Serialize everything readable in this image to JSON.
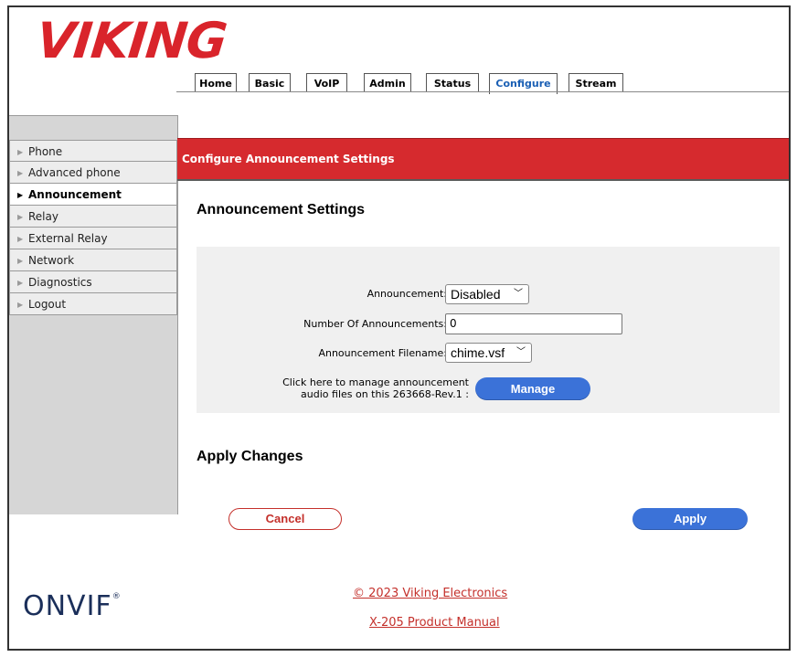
{
  "brand": {
    "logo_text": "VIKING",
    "logo_color": "#d9242b"
  },
  "tabs": [
    {
      "label": "Home"
    },
    {
      "label": "Basic"
    },
    {
      "label": "VoIP"
    },
    {
      "label": "Admin"
    },
    {
      "label": "Status"
    },
    {
      "label": "Configure",
      "active": true
    },
    {
      "label": "Stream"
    }
  ],
  "sidebar": {
    "items": [
      {
        "label": "Phone"
      },
      {
        "label": "Advanced phone"
      },
      {
        "label": "Announcement",
        "active": true
      },
      {
        "label": "Relay"
      },
      {
        "label": "External Relay"
      },
      {
        "label": "Network"
      },
      {
        "label": "Diagnostics"
      },
      {
        "label": "Logout"
      }
    ]
  },
  "banner": {
    "title": "Configure Announcement Settings",
    "color": "#d62a2e"
  },
  "settings": {
    "heading": "Announcement Settings",
    "announcement_label": "Announcement:",
    "announcement_value": "Disabled",
    "count_label": "Number Of Announcements:",
    "count_value": "0",
    "filename_label": "Announcement Filename:",
    "filename_value": "chime.vsf",
    "manage_line1": "Click here to manage announcement",
    "manage_line2": "audio files on this 263668-Rev.1 :",
    "manage_button": "Manage"
  },
  "apply": {
    "heading": "Apply Changes",
    "cancel_label": "Cancel",
    "apply_label": "Apply"
  },
  "footer": {
    "copyright": "© 2023 Viking Electronics",
    "manual": "X-205 Product Manual",
    "onvif_text": "ONVIF",
    "onvif_reg": "®"
  },
  "colors": {
    "accent_blue": "#3b72d8",
    "accent_red": "#c4302b"
  }
}
